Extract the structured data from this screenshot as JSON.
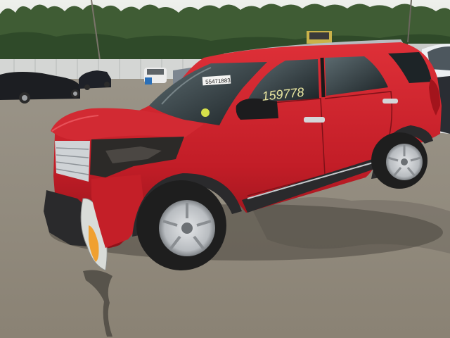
{
  "photo": {
    "sticker_text": "55471883",
    "window_marker_text": "159778"
  },
  "colors": {
    "sky": "#e6e8e4",
    "trees": "#3d5a32",
    "ground": "#8b8476",
    "car_body": "#c9202a",
    "car_shadow": "#8e1219",
    "tire": "#1e1e1e",
    "rim": "#c9ccd0"
  }
}
